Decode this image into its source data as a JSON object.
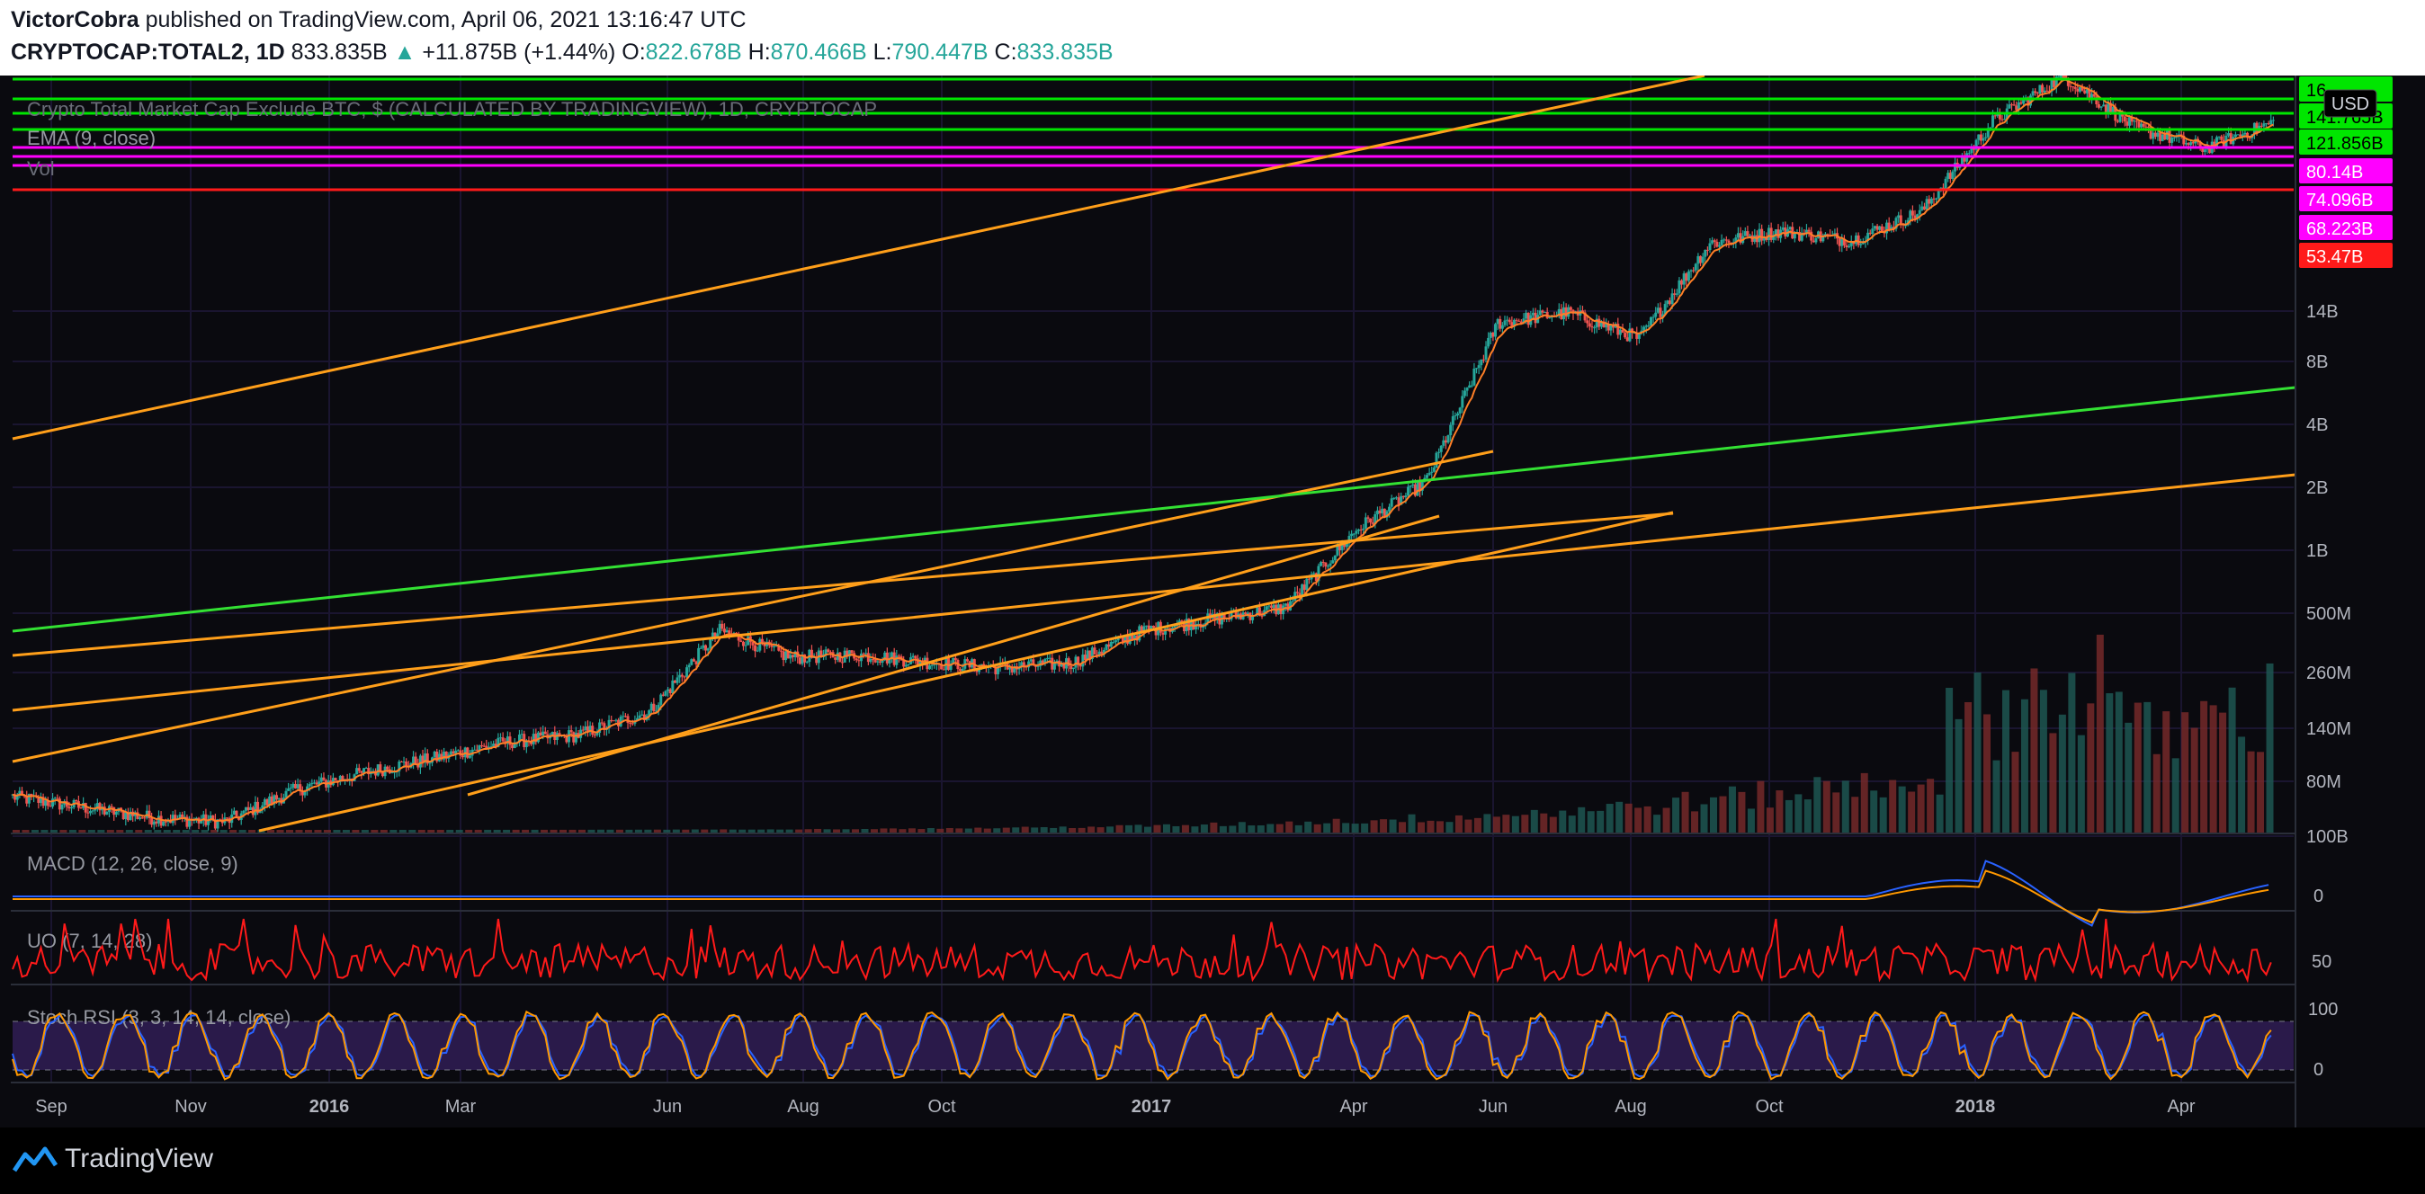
{
  "header": {
    "author": "VictorCobra",
    "published_text": "published on TradingView.com, April 06, 2021 13:16:47 UTC",
    "symbol": "CRYPTOCAP:TOTAL2, 1D",
    "last": "833.835B",
    "change": "+11.875B (+1.44%)",
    "o_label": "O:",
    "o": "822.678B",
    "h_label": "H:",
    "h": "870.466B",
    "l_label": "L:",
    "l": "790.447B",
    "c_label": "C:",
    "c": "833.835B"
  },
  "legend": {
    "study_title": "Crypto Total Market Cap Exclude BTC, $ (CALCULATED BY TRADINGVIEW), 1D, CRYPTOCAP",
    "ema": "EMA (9, close)",
    "vol": "Vol"
  },
  "currency": "USD",
  "price_labels": [
    {
      "text": "16",
      "color": "#00e600"
    },
    {
      "text": "141.765B",
      "color": "#00e600"
    },
    {
      "text": "121.856B",
      "color": "#00e600"
    },
    {
      "text": "80.14B",
      "color": "#ff00ff"
    },
    {
      "text": "74.096B",
      "color": "#ff00ff"
    },
    {
      "text": "68.223B",
      "color": "#ff00ff"
    },
    {
      "text": "53.47B",
      "color": "#ff1a1a"
    }
  ],
  "y_ticks": [
    "14B",
    "8B",
    "4B",
    "2B",
    "1B",
    "500M",
    "260M",
    "140M",
    "80M",
    "100B"
  ],
  "x_ticks": [
    "Sep",
    "Nov",
    "2016",
    "Mar",
    "Jun",
    "Aug",
    "Oct",
    "2017",
    "Apr",
    "Jun",
    "Aug",
    "Oct",
    "2018",
    "Apr"
  ],
  "panes": {
    "macd": {
      "title": "MACD (12, 26, close, 9)",
      "tick": "0"
    },
    "uo": {
      "title": "UO (7, 14, 28)",
      "tick": "50"
    },
    "stoch": {
      "title": "Stoch RSI (3, 3, 14, 14, close)",
      "ticks": [
        "100",
        "0"
      ]
    }
  },
  "colors": {
    "up": "#26a69a",
    "down": "#ef5350",
    "ema": "#ff7f27",
    "trend_orange": "#ff9f1a",
    "trend_green": "#33e133",
    "level_green": "#00e600",
    "level_magenta": "#ff00ff",
    "level_red": "#ff1a1a",
    "macd": "#2962ff",
    "signal": "#ff9800",
    "uo": "#ff1a1a",
    "stoch_k": "#2962ff",
    "stoch_d": "#ff9800",
    "stoch_band": "#2a1a4a"
  },
  "footer": {
    "brand": "TradingView"
  },
  "chart_data": {
    "type": "candlestick",
    "scale": "log",
    "title": "CRYPTOCAP:TOTAL2, 1D",
    "price_series": {
      "name": "TOTAL2",
      "x": [
        "2015-08",
        "2015-09",
        "2015-10",
        "2015-11",
        "2015-12",
        "2016-01",
        "2016-02",
        "2016-03",
        "2016-04",
        "2016-05",
        "2016-06",
        "2016-07",
        "2016-08",
        "2016-09",
        "2016-10",
        "2016-11",
        "2016-12",
        "2017-01",
        "2017-02",
        "2017-03",
        "2017-04",
        "2017-05",
        "2017-06",
        "2017-07",
        "2017-08",
        "2017-09",
        "2017-10",
        "2017-11",
        "2017-12",
        "2018-01",
        "2018-02",
        "2018-03",
        "2018-04"
      ],
      "values": [
        0.055,
        0.048,
        0.042,
        0.04,
        0.06,
        0.075,
        0.09,
        0.11,
        0.12,
        0.16,
        0.45,
        0.32,
        0.33,
        0.3,
        0.28,
        0.3,
        0.45,
        0.52,
        0.6,
        1.6,
        3.0,
        22,
        25,
        18,
        60,
        70,
        62,
        90,
        280,
        500,
        260,
        200,
        280
      ]
    },
    "horizontal_levels": [
      {
        "value": "141.765B",
        "color": "green"
      },
      {
        "value": "121.856B",
        "color": "green"
      },
      {
        "value": "80.14B",
        "color": "magenta"
      },
      {
        "value": "74.096B",
        "color": "magenta"
      },
      {
        "value": "68.223B",
        "color": "magenta"
      },
      {
        "value": "53.47B",
        "color": "red"
      }
    ],
    "volume": {
      "name": "Vol",
      "peak_month": "2018-01"
    },
    "macd": {
      "name": "MACD (12, 26, close, 9)",
      "note": "near 0 until late 2017, peak Jan 2018"
    },
    "uo": {
      "name": "UO (7, 14, 28)",
      "mid": 50
    },
    "stoch_rsi": {
      "name": "Stoch RSI (3, 3, 14, 14, close)",
      "range": [
        0,
        100
      ]
    }
  }
}
